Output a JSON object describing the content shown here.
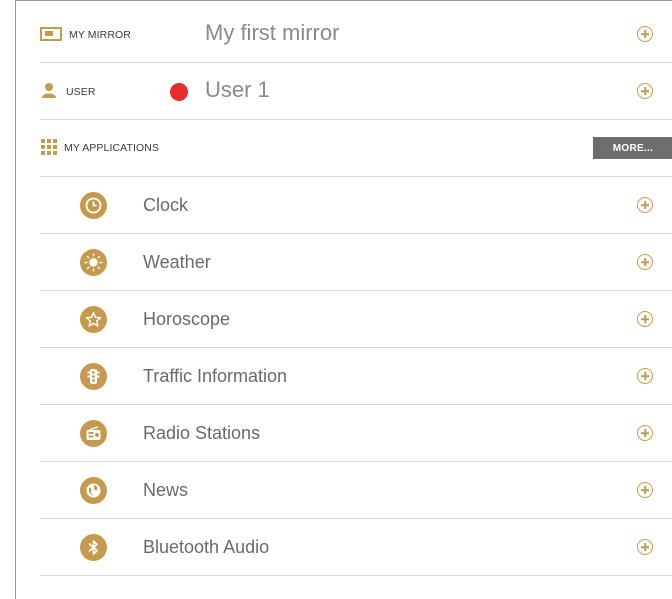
{
  "mirror": {
    "label": "MY MIRROR",
    "value": "My first mirror"
  },
  "user": {
    "label": "USER",
    "value": "User 1",
    "status_color": "#e62c2c"
  },
  "applications": {
    "label": "MY APPLICATIONS",
    "more_label": "MORE...",
    "items": [
      {
        "label": "Clock",
        "icon": "clock-icon"
      },
      {
        "label": "Weather",
        "icon": "sun-icon"
      },
      {
        "label": "Horoscope",
        "icon": "star-icon"
      },
      {
        "label": "Traffic Information",
        "icon": "traffic-light-icon"
      },
      {
        "label": "Radio Stations",
        "icon": "radio-icon"
      },
      {
        "label": "News",
        "icon": "globe-icon"
      },
      {
        "label": "Bluetooth Audio",
        "icon": "bluetooth-icon"
      }
    ]
  },
  "colors": {
    "accent": "#c59a4c",
    "button": "#6d6d6d",
    "divider": "#d8d8d8"
  }
}
